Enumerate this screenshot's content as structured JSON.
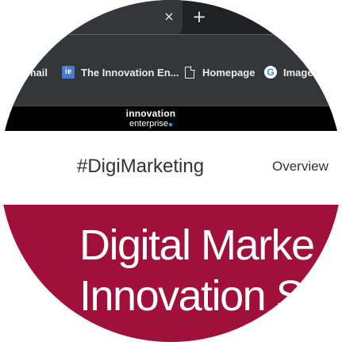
{
  "browser": {
    "tab_close_glyph": "×",
    "new_tab_glyph": "+",
    "bookmarks": [
      {
        "label": "mail",
        "icon": "none"
      },
      {
        "label": "The Innovation En...",
        "icon": "ie-icon",
        "icon_text": "ie"
      },
      {
        "label": "Homepage",
        "icon": "document-icon"
      },
      {
        "label": "Images",
        "icon": "google-icon",
        "icon_text": "G"
      }
    ]
  },
  "site": {
    "logo_top": "innovation",
    "logo_bottom": "enterprise",
    "nav_title": "#DigiMarketing",
    "nav_link": "Overview",
    "hero_line1": "Digital Marke",
    "hero_line2": "Innovation S"
  },
  "colors": {
    "tabstrip": "#202124",
    "toolbar": "#35363a",
    "header": "#000000",
    "hero": "#a0103b",
    "logo_accent": "#2ea3f2"
  }
}
